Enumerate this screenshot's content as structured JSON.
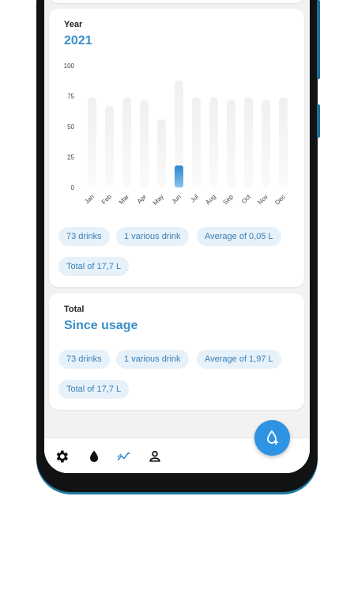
{
  "year_card": {
    "label": "Year",
    "value": "2021",
    "chips": [
      "73 drinks",
      "1 various drink",
      "Average of 0,05 L",
      "Total of 17,7 L"
    ]
  },
  "total_card": {
    "label": "Total",
    "value": "Since usage",
    "chips": [
      "73 drinks",
      "1 various drink",
      "Average of 1,97 L",
      "Total of 17,7 L"
    ]
  },
  "chart_data": {
    "type": "bar",
    "categories": [
      "Jan",
      "Feb",
      "Mar",
      "Apr",
      "May",
      "Jun",
      "Jul",
      "Aug",
      "Sep",
      "Oct",
      "Nov",
      "Dec"
    ],
    "values": [
      0,
      0,
      0,
      0,
      0,
      18,
      0,
      0,
      0,
      0,
      0,
      0
    ],
    "background_values": [
      74,
      67,
      74,
      72,
      56,
      88,
      74,
      74,
      72,
      74,
      72,
      74
    ],
    "ylim": [
      0,
      100
    ],
    "yticks": [
      0,
      25,
      50,
      75,
      100
    ],
    "title": "",
    "xlabel": "",
    "ylabel": "",
    "accent_color": "#3a8ec9"
  },
  "nav": {
    "items": [
      {
        "icon": "gear-icon"
      },
      {
        "icon": "water-drop-icon"
      },
      {
        "icon": "statistics-icon"
      },
      {
        "icon": "person-icon"
      }
    ],
    "fab_icon": "add-drop-icon"
  }
}
